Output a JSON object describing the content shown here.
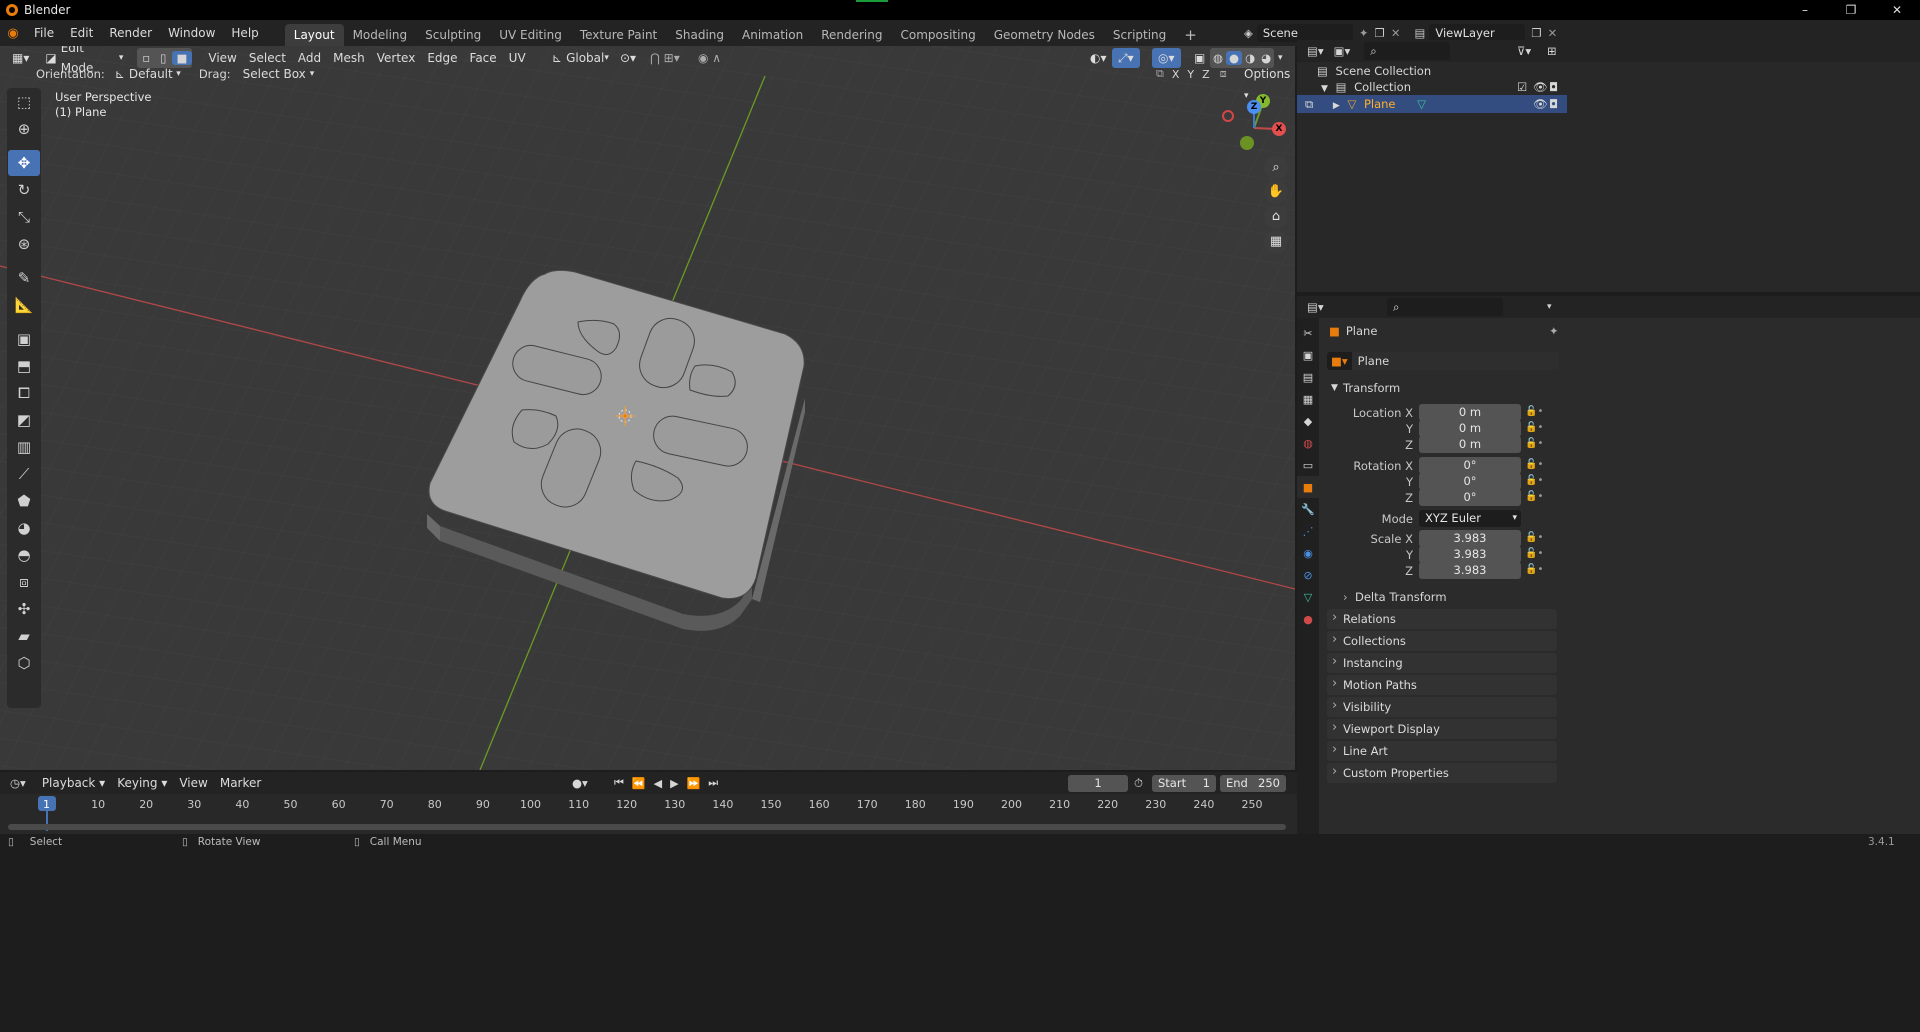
{
  "titlebar": {
    "app_title": "Blender",
    "controls": [
      "–",
      "❐",
      "✕"
    ]
  },
  "menu": [
    "File",
    "Edit",
    "Render",
    "Window",
    "Help"
  ],
  "workspaces": [
    "Layout",
    "Modeling",
    "Sculpting",
    "UV Editing",
    "Texture Paint",
    "Shading",
    "Animation",
    "Rendering",
    "Compositing",
    "Geometry Nodes",
    "Scripting"
  ],
  "workspace_add": "+",
  "scene": {
    "label": "Scene",
    "viewlayer": "ViewLayer"
  },
  "viewport_header": {
    "mode": "Edit Mode",
    "menus": [
      "View",
      "Select",
      "Add",
      "Mesh",
      "Vertex",
      "Edge",
      "Face",
      "UV"
    ],
    "transform_orientation": "Global",
    "orientation_label": "Orientation:",
    "orientation_value": "Default",
    "drag_label": "Drag:",
    "drag_value": "Select Box",
    "options": "Options",
    "axes": [
      "X",
      "Y",
      "Z"
    ]
  },
  "viewport_overlay": {
    "perspective": "User Perspective",
    "object": "(1) Plane"
  },
  "gizmo": {
    "x": "X",
    "y": "Y",
    "z": "Z"
  },
  "outliner": {
    "scene_collection": "Scene Collection",
    "collection": "Collection",
    "object": "Plane"
  },
  "properties": {
    "object_name": "Plane",
    "object_data_name": "Plane",
    "transform_title": "Transform",
    "location": {
      "label_x": "Location X",
      "label_y": "Y",
      "label_z": "Z",
      "x": "0 m",
      "y": "0 m",
      "z": "0 m"
    },
    "rotation": {
      "label_x": "Rotation X",
      "label_y": "Y",
      "label_z": "Z",
      "x": "0°",
      "y": "0°",
      "z": "0°"
    },
    "mode": {
      "label": "Mode",
      "value": "XYZ Euler"
    },
    "scale": {
      "label_x": "Scale X",
      "label_y": "Y",
      "label_z": "Z",
      "x": "3.983",
      "y": "3.983",
      "z": "3.983"
    },
    "delta": "Delta Transform",
    "panels": [
      "Relations",
      "Collections",
      "Instancing",
      "Motion Paths",
      "Visibility",
      "Viewport Display",
      "Line Art",
      "Custom Properties"
    ]
  },
  "timeline": {
    "menus": [
      "Playback",
      "Keying",
      "View",
      "Marker"
    ],
    "current_frame": "1",
    "start_label": "Start",
    "start": "1",
    "end_label": "End",
    "end": "250",
    "ticks": [
      "1",
      "10",
      "20",
      "30",
      "40",
      "50",
      "60",
      "70",
      "80",
      "90",
      "100",
      "110",
      "120",
      "130",
      "140",
      "150",
      "160",
      "170",
      "180",
      "190",
      "200",
      "210",
      "220",
      "230",
      "240",
      "250"
    ]
  },
  "statusbar": {
    "select": "Select",
    "rotate": "Rotate View",
    "call_menu": "Call Menu",
    "version": "3.4.1"
  },
  "colors": {
    "accent_blue": "#4772b3",
    "x_axis": "#c04a4a",
    "y_axis": "#6c9a22",
    "orange": "#e87d0d"
  }
}
